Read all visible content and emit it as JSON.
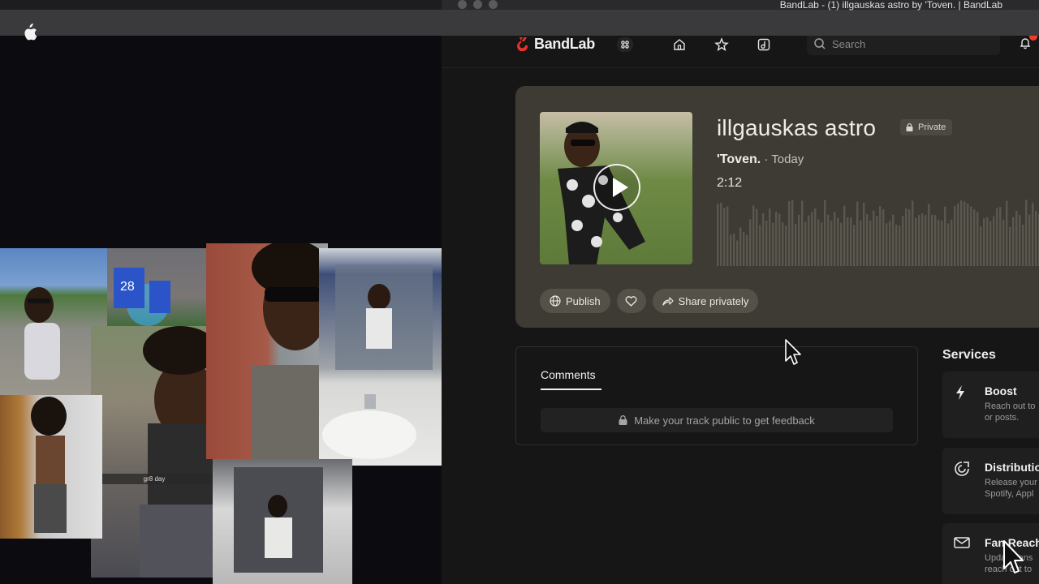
{
  "window": {
    "title": "BandLab - (1) illgauskas astro by 'Toven. | BandLab"
  },
  "collage": {
    "caption": "gr8 day"
  },
  "nav": {
    "logo_text": "BandLab",
    "search_placeholder": "Search",
    "notification_color": "#f03c2e"
  },
  "track": {
    "title": "illgauskas astro",
    "privacy": "Private",
    "artist": "'Toven.",
    "date": " · Today",
    "duration": "2:12"
  },
  "actions": {
    "publish": "Publish",
    "share": "Share privately"
  },
  "comments": {
    "tab": "Comments",
    "notice": "Make your track public to get feedback"
  },
  "services": {
    "title": "Services",
    "items": [
      {
        "name": "Boost",
        "desc_line1": "Reach out to",
        "desc_line2": "or posts.",
        "icon": "bolt-icon"
      },
      {
        "name": "Distribution",
        "desc_line1": "Release your",
        "desc_line2": "Spotify, Appl",
        "icon": "distribution-icon"
      },
      {
        "name": "Fan Reach",
        "desc_line1": "Update fans",
        "desc_line2": "reach out to",
        "icon": "mail-icon"
      }
    ]
  },
  "colors": {
    "card_bg": "#3d3b34",
    "page_bg": "#161616",
    "brand_red": "#e8322a"
  }
}
